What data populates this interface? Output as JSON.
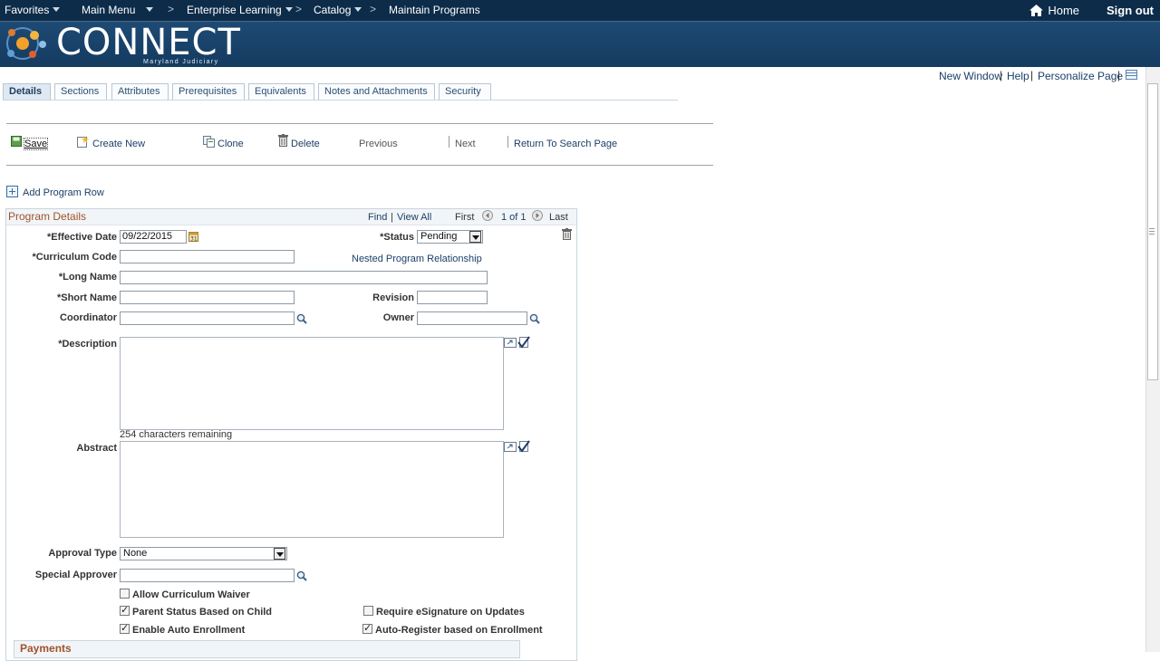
{
  "topnav": {
    "favorites": "Favorites",
    "main_menu": "Main Menu",
    "sep": ">",
    "enterprise_learning": "Enterprise Learning",
    "catalog": "Catalog",
    "current": "Maintain Programs",
    "home": "Home",
    "sign_out": "Sign out"
  },
  "brand": {
    "name": "CONNECT",
    "subtitle": "Maryland Judiciary"
  },
  "page_links": {
    "new_window": "New Window",
    "help": "Help",
    "personalize": "Personalize Page",
    "pipe": "|"
  },
  "tabs": [
    "Details",
    "Sections",
    "Attributes",
    "Prerequisites",
    "Equivalents",
    "Notes and Attachments",
    "Security"
  ],
  "toolbar": {
    "save": "Save",
    "create_new": "Create New",
    "clone": "Clone",
    "delete": "Delete",
    "previous": "Previous",
    "next": "Next",
    "return_search": "Return To Search Page"
  },
  "add_program_row": "Add Program Row",
  "program_details": {
    "title": "Program Details",
    "find": "Find",
    "view_all": "View All",
    "first": "First",
    "count": "1 of 1",
    "last": "Last",
    "pipe": "|"
  },
  "fields": {
    "effective_date_label": "*Effective Date",
    "effective_date_value": "09/22/2015",
    "status_label": "*Status",
    "status_value": "Pending",
    "curriculum_code_label": "*Curriculum Code",
    "nested_link": "Nested Program Relationship",
    "long_name_label": "*Long Name",
    "short_name_label": "*Short Name",
    "revision_label": "Revision",
    "coordinator_label": "Coordinator",
    "owner_label": "Owner",
    "description_label": "*Description",
    "chars_remaining": "254 characters remaining",
    "abstract_label": "Abstract",
    "approval_type_label": "Approval Type",
    "approval_type_value": "None",
    "special_approver_label": "Special Approver"
  },
  "checkboxes": {
    "allow_waiver": {
      "label": "Allow Curriculum Waiver",
      "checked": false
    },
    "parent_status": {
      "label": "Parent Status Based on Child",
      "checked": true
    },
    "require_esig": {
      "label": "Require eSignature on Updates",
      "checked": false
    },
    "auto_enroll": {
      "label": "Enable Auto Enrollment",
      "checked": true
    },
    "auto_register": {
      "label": "Auto-Register based on Enrollment",
      "checked": true
    }
  },
  "payments_title": "Payments",
  "colors": {
    "nav_bg": "#0d2c4a",
    "banner_bg": "#1d4a74",
    "link": "#1b3f68",
    "group_title": "#a0522d"
  }
}
